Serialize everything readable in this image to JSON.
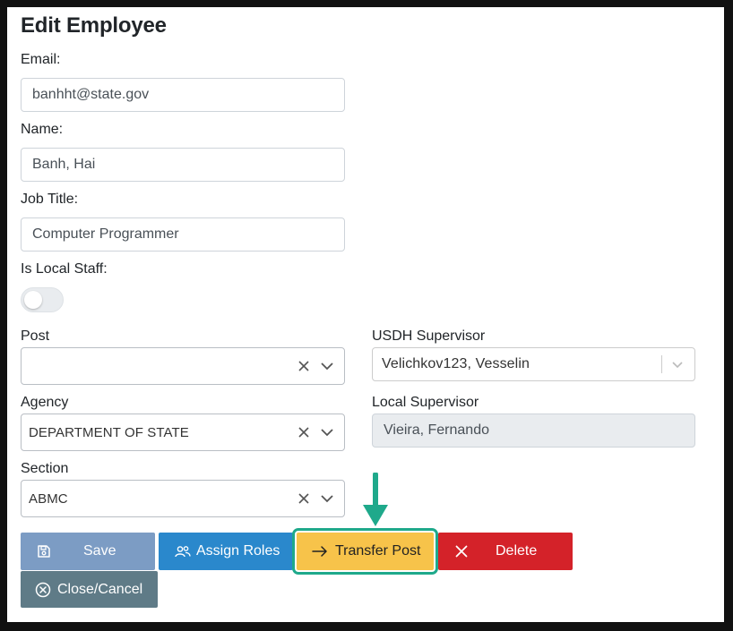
{
  "header": {
    "title": "Edit Employee"
  },
  "fields": {
    "email": {
      "label": "Email:",
      "value": "banhht@state.gov"
    },
    "name": {
      "label": "Name:",
      "value": "Banh, Hai"
    },
    "job_title": {
      "label": "Job Title:",
      "value": "Computer Programmer"
    },
    "local_staff": {
      "label": "Is Local Staff:",
      "checked": false
    }
  },
  "selects": {
    "post": {
      "label": "Post",
      "value": ""
    },
    "agency": {
      "label": "Agency",
      "value": "DEPARTMENT OF STATE"
    },
    "section": {
      "label": "Section",
      "value": "ABMC"
    },
    "usdh_supervisor": {
      "label": "USDH Supervisor",
      "value": "Velichkov123, Vesselin"
    },
    "local_supervisor": {
      "label": "Local Supervisor",
      "value": "Vieira, Fernando"
    }
  },
  "buttons": {
    "save": "Save",
    "assign_roles": "Assign Roles",
    "transfer_post": "Transfer Post",
    "delete": "Delete",
    "close_cancel": "Close/Cancel"
  },
  "colors": {
    "save": "#7c9cc4",
    "assign_roles": "#2a88cc",
    "transfer_post": "#f7c34a",
    "delete": "#d42229",
    "close_cancel": "#5f7b87",
    "highlight": "#1fa98b"
  },
  "icons": {
    "save": "floppy-disk-icon",
    "assign_roles": "users-icon",
    "transfer_post": "arrow-right-icon",
    "delete": "x-icon",
    "close_cancel": "circle-x-icon",
    "callout": "arrow-down-icon"
  }
}
